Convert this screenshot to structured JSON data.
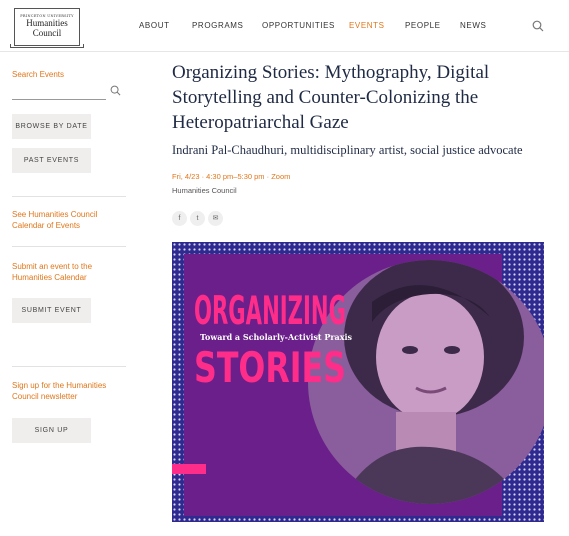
{
  "header": {
    "logo": {
      "line1": "PRINCETON UNIVERSITY",
      "line2": "Humanities",
      "line3": "Council"
    },
    "nav": [
      {
        "label": "ABOUT"
      },
      {
        "label": "PROGRAMS"
      },
      {
        "label": "OPPORTUNITIES"
      },
      {
        "label": "EVENTS"
      },
      {
        "label": "PEOPLE"
      },
      {
        "label": "NEWS"
      }
    ],
    "active_nav": "EVENTS",
    "search_icon": "search-icon"
  },
  "sidebar": {
    "search_label": "Search Events",
    "search_value": "",
    "browse_by_date": "BROWSE BY DATE",
    "past_events": "PAST EVENTS",
    "calendar_link": [
      "See Humanities Council",
      "Calendar of Events"
    ],
    "submit_link": [
      "Submit an event to the",
      "Humanities Calendar"
    ],
    "submit_button": "SUBMIT EVENT",
    "newsletter_link": [
      "Sign up for the Humanities",
      "Council newsletter"
    ],
    "signup_button": "SIGN UP"
  },
  "event": {
    "title_lines": [
      "Organizing Stories: Mythography, Digital",
      "Storytelling and Counter-Colonizing the",
      "Heteropatriarchal Gaze"
    ],
    "subtitle": "Indrani Pal-Chaudhuri, multidisciplinary artist, social justice advocate",
    "meta": "Fri, 4/23 · 4:30 pm–5:30 pm · Zoom",
    "organizer": "Humanities Council",
    "share": [
      {
        "icon": "facebook-icon",
        "glyph": "f"
      },
      {
        "icon": "twitter-icon",
        "glyph": "t"
      },
      {
        "icon": "email-icon",
        "glyph": "✉"
      }
    ]
  },
  "hero": {
    "word1": "ORGANIZING",
    "tagline": "Toward a Scholarly-Activist Praxis",
    "word2": "STORIES",
    "colors": {
      "blue": "#2e2a8f",
      "purple": "#6b1f8a",
      "pink": "#ff2d8a",
      "photo": "#9c6fa8"
    }
  },
  "colors": {
    "accent": "#e0761a",
    "title": "#1f2a44",
    "button_bg": "#efeeec"
  }
}
